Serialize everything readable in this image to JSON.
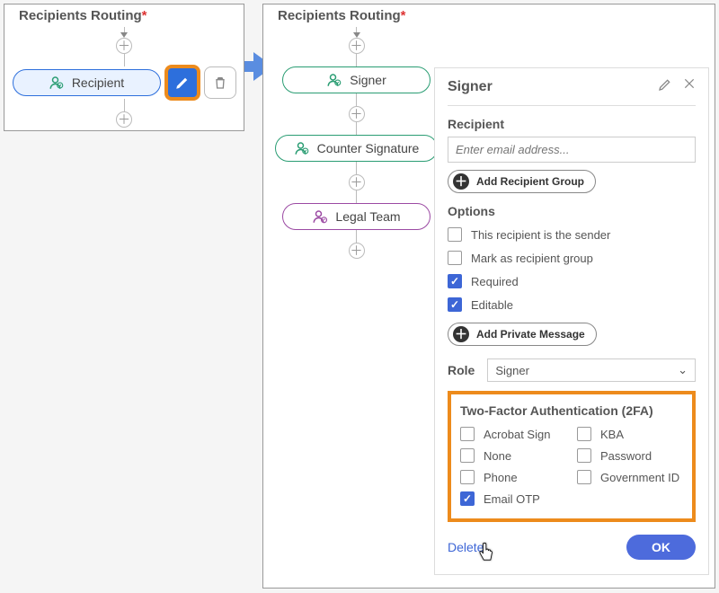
{
  "left": {
    "heading": "Recipients Routing",
    "node": "Recipient"
  },
  "right": {
    "heading": "Recipients Routing",
    "nodes": [
      "Signer",
      "Counter Signature",
      "Legal Team"
    ]
  },
  "panel": {
    "title": "Signer",
    "recipientLabel": "Recipient",
    "emailPlaceholder": "Enter email address...",
    "addGroupBtn": "Add Recipient Group",
    "optionsLabel": "Options",
    "opts": {
      "sender": {
        "label": "This recipient is the sender",
        "checked": false
      },
      "group": {
        "label": "Mark as recipient group",
        "checked": false
      },
      "required": {
        "label": "Required",
        "checked": true
      },
      "editable": {
        "label": "Editable",
        "checked": true
      }
    },
    "addPrivate": "Add Private Message",
    "roleLabel": "Role",
    "roleValue": "Signer",
    "tfaLabel": "Two-Factor Authentication (2FA)",
    "tfa": {
      "acrobat": {
        "label": "Acrobat Sign",
        "checked": false
      },
      "kba": {
        "label": "KBA",
        "checked": false
      },
      "none": {
        "label": "None",
        "checked": false
      },
      "password": {
        "label": "Password",
        "checked": false
      },
      "phone": {
        "label": "Phone",
        "checked": false
      },
      "govid": {
        "label": "Government ID",
        "checked": false
      },
      "emailotp": {
        "label": "Email OTP",
        "checked": true
      }
    },
    "deleteLabel": "Delete",
    "okLabel": "OK"
  }
}
